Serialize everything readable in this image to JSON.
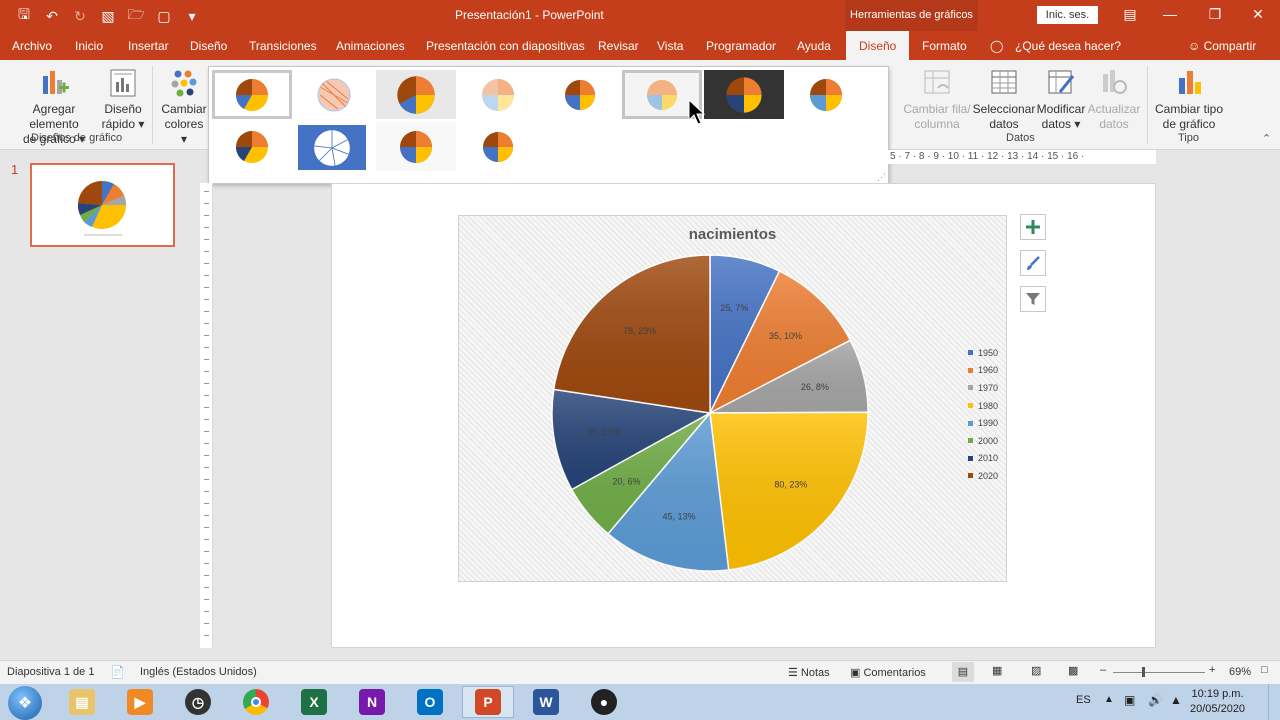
{
  "window": {
    "title": "Presentación1  -  PowerPoint",
    "context_tab_group": "Herramientas de gráficos",
    "signin": "Inic. ses."
  },
  "tabs": [
    "Archivo",
    "Inicio",
    "Insertar",
    "Diseño",
    "Transiciones",
    "Animaciones",
    "Presentación con diapositivas",
    "Revisar",
    "Vista",
    "Programador",
    "Ayuda",
    "Diseño",
    "Formato"
  ],
  "tellme": "¿Qué desea hacer?",
  "share": "Compartir",
  "ribbon": {
    "add_element": [
      "Agregar elemento",
      "de gráfico ▾"
    ],
    "quick_layout": [
      "Diseño",
      "rápido ▾"
    ],
    "change_colors": [
      "Cambiar",
      "colores ▾"
    ],
    "group_layouts": "Diseños de gráfico",
    "switch_row_col": [
      "Cambiar fila/",
      "columna"
    ],
    "select_data": [
      "Seleccionar",
      "datos"
    ],
    "edit_data": [
      "Modificar",
      "datos ▾"
    ],
    "refresh_data": [
      "Actualizar",
      "datos"
    ],
    "group_data": "Datos",
    "change_type": [
      "Cambiar tipo",
      "de gráfico"
    ],
    "group_type": "Tipo"
  },
  "slide_number": "1",
  "ruler_text": "5 · 7 · 8 · 9 · 10 · 11 · 12 · 13 · 14 · 15 · 16 ·",
  "chart_data": {
    "type": "pie",
    "title": "nacimientos",
    "categories": [
      "1950",
      "1960",
      "1970",
      "1980",
      "1990",
      "2000",
      "2010",
      "2020"
    ],
    "values": [
      25,
      35,
      26,
      80,
      45,
      20,
      36,
      78
    ],
    "data_labels": [
      "25, 7%",
      "35, 10%",
      "26, 8%",
      "80, 23%",
      "45, 13%",
      "20, 6%",
      "36, 10%",
      "78, 23%"
    ],
    "colors": [
      "#4472c4",
      "#ed7d31",
      "#a5a5a5",
      "#ffc000",
      "#5b9bd5",
      "#70ad47",
      "#264478",
      "#9e480e"
    ],
    "legend": "right"
  },
  "status": {
    "slide": "Diapositiva 1 de 1",
    "language": "Inglés (Estados Unidos)",
    "notes": "Notas",
    "comments": "Comentarios",
    "zoom": "69%"
  },
  "taskbar": {
    "lang": "ES",
    "time": "10:19 p.m.",
    "date": "20/05/2020"
  }
}
